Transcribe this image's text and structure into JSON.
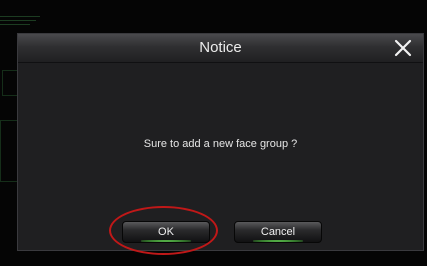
{
  "dialog": {
    "title": "Notice",
    "close_icon": "close-x-icon",
    "message": "Sure to add a new face group ?",
    "ok_label": "OK",
    "cancel_label": "Cancel"
  },
  "colors": {
    "dialog_background": "#1f1f21",
    "highlight_ring": "#c01818",
    "button_glow": "#7be06a"
  }
}
